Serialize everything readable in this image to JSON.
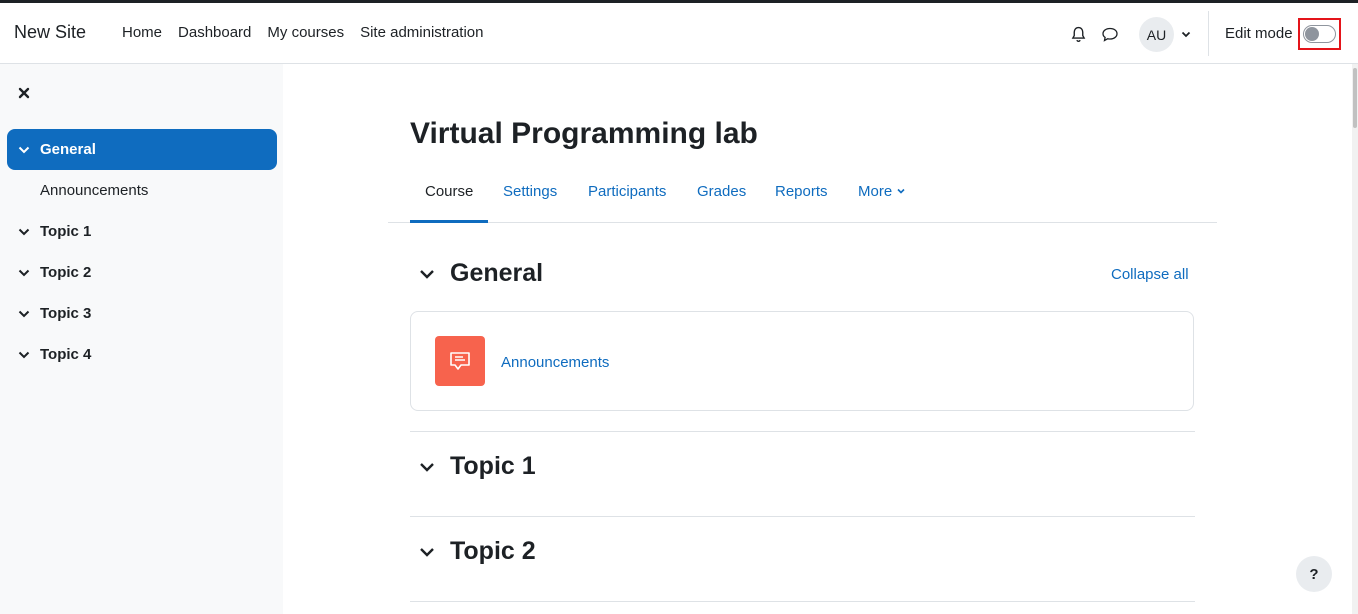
{
  "site": {
    "brand": "New Site"
  },
  "primary_nav": [
    "Home",
    "Dashboard",
    "My courses",
    "Site administration"
  ],
  "user": {
    "initials": "AU"
  },
  "edit_mode": {
    "label": "Edit mode",
    "enabled": false
  },
  "drawer": {
    "items": [
      {
        "label": "General",
        "active": true
      },
      {
        "label": "Announcements",
        "sub": true
      },
      {
        "label": "Topic 1"
      },
      {
        "label": "Topic 2"
      },
      {
        "label": "Topic 3"
      },
      {
        "label": "Topic 4"
      }
    ]
  },
  "course": {
    "title": "Virtual Programming lab",
    "tabs": [
      "Course",
      "Settings",
      "Participants",
      "Grades",
      "Reports",
      "More"
    ],
    "active_tab": "Course",
    "collapse_all": "Collapse all",
    "sections": [
      {
        "title": "General",
        "activities": [
          {
            "name": "Announcements",
            "type": "forum"
          }
        ]
      },
      {
        "title": "Topic 1"
      },
      {
        "title": "Topic 2"
      }
    ]
  },
  "help": {
    "label": "?"
  },
  "colors": {
    "brand_blue": "#0f6cbf",
    "forum_icon_bg": "#f7634d",
    "highlight_red": "#e4141a"
  }
}
